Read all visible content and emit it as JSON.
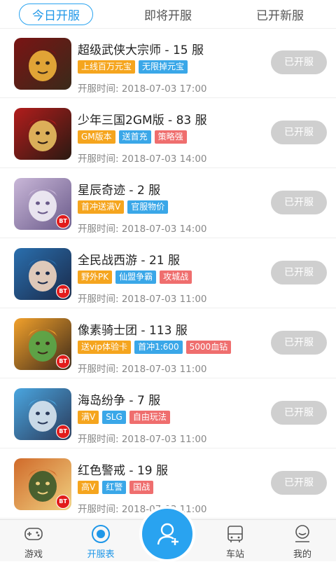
{
  "tabs": [
    {
      "label": "今日开服"
    },
    {
      "label": "即将开服"
    },
    {
      "label": "已开新服"
    }
  ],
  "colors": {
    "accent": "#29a3f0",
    "orange": "#f5a51e",
    "blue": "#3aa7e8",
    "red": "#ef6e6e",
    "button": "#cfcfcf"
  },
  "time_prefix": "开服时间: ",
  "games": [
    {
      "title": "超级武侠大宗师 - 15 服",
      "tags": [
        {
          "text": "上线百万元宝",
          "color": "orange"
        },
        {
          "text": "无限掉元宝",
          "color": "blue"
        }
      ],
      "time": "开服时间: 2018-07-03 17:00",
      "status": "已开服",
      "bt": ""
    },
    {
      "title": "少年三国2GM版 - 83 服",
      "tags": [
        {
          "text": "GM版本",
          "color": "orange"
        },
        {
          "text": "送首充",
          "color": "blue"
        },
        {
          "text": "策略强",
          "color": "red"
        }
      ],
      "time": "开服时间: 2018-07-03 14:00",
      "status": "已开服",
      "bt": ""
    },
    {
      "title": "星辰奇迹 - 2 服",
      "tags": [
        {
          "text": "首冲送满V",
          "color": "orange"
        },
        {
          "text": "官服物价",
          "color": "blue"
        }
      ],
      "time": "开服时间: 2018-07-03 14:00",
      "status": "已开服",
      "bt": "BT"
    },
    {
      "title": "全民战西游 - 21 服",
      "tags": [
        {
          "text": "野外PK",
          "color": "orange"
        },
        {
          "text": "仙盟争霸",
          "color": "blue"
        },
        {
          "text": "攻城战",
          "color": "red"
        }
      ],
      "time": "开服时间: 2018-07-03 11:00",
      "status": "已开服",
      "bt": "BT"
    },
    {
      "title": "像素骑士团 - 113 服",
      "tags": [
        {
          "text": "送vip体验卡",
          "color": "orange"
        },
        {
          "text": "首冲1:600",
          "color": "blue"
        },
        {
          "text": "5000血钻",
          "color": "red"
        }
      ],
      "time": "开服时间: 2018-07-03 11:00",
      "status": "已开服",
      "bt": "BT"
    },
    {
      "title": "海岛纷争 - 7 服",
      "tags": [
        {
          "text": "满V",
          "color": "orange"
        },
        {
          "text": "SLG",
          "color": "blue"
        },
        {
          "text": "自由玩法",
          "color": "red"
        }
      ],
      "time": "开服时间: 2018-07-03 11:00",
      "status": "已开服",
      "bt": "BT"
    },
    {
      "title": "红色警戒 - 19 服",
      "tags": [
        {
          "text": "高V",
          "color": "orange"
        },
        {
          "text": "红警",
          "color": "blue"
        },
        {
          "text": "国战",
          "color": "red"
        }
      ],
      "time": "开服时间: 2018-07-03 11:00",
      "status": "已开服",
      "bt": "BT"
    }
  ],
  "nav": [
    {
      "label": "游戏",
      "icon": "gamepad-icon"
    },
    {
      "label": "开服表",
      "icon": "server-list-icon"
    },
    {
      "label": "",
      "icon": "add-user-icon"
    },
    {
      "label": "车站",
      "icon": "bus-icon"
    },
    {
      "label": "我的",
      "icon": "profile-icon"
    }
  ]
}
